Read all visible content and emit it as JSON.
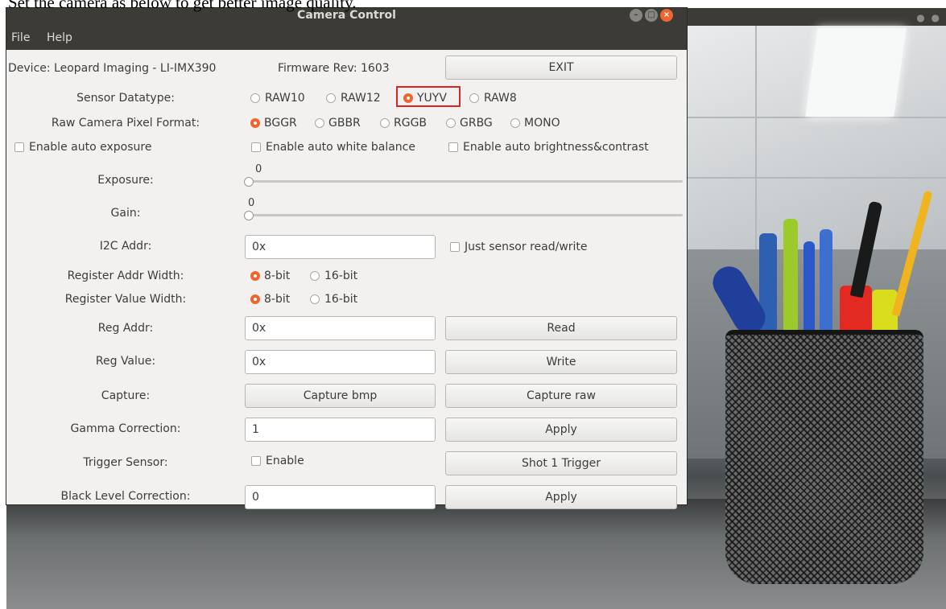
{
  "caption": "Set the camera as below to get better image quality.",
  "window": {
    "title": "Camera Control",
    "menu": [
      "File",
      "Help"
    ]
  },
  "header": {
    "device": "Device: Leopard Imaging - LI-IMX390",
    "firmware": "Firmware Rev: 1603",
    "exit_label": "EXIT"
  },
  "sensor_datatype": {
    "label": "Sensor Datatype:",
    "options": [
      "RAW10",
      "RAW12",
      "YUYV",
      "RAW8"
    ],
    "selected": "YUYV"
  },
  "pixel_format": {
    "label": "Raw Camera Pixel Format:",
    "options": [
      "BGGR",
      "GBBR",
      "RGGB",
      "GRBG",
      "MONO"
    ],
    "selected": "BGGR"
  },
  "checkboxes": {
    "auto_exposure": "Enable auto exposure",
    "auto_white_balance": "Enable auto white balance",
    "auto_brightness": "Enable auto brightness&contrast"
  },
  "exposure": {
    "label": "Exposure:",
    "value": "0"
  },
  "gain": {
    "label": "Gain:",
    "value": "0"
  },
  "i2c": {
    "label": "I2C Addr:",
    "value": "0x",
    "just_sensor": "Just sensor read/write"
  },
  "reg_addr_width": {
    "label": "Register Addr Width:",
    "options": [
      "8-bit",
      "16-bit"
    ],
    "selected": "8-bit"
  },
  "reg_value_width": {
    "label": "Register Value Width:",
    "options": [
      "8-bit",
      "16-bit"
    ],
    "selected": "8-bit"
  },
  "reg_addr": {
    "label": "Reg Addr:",
    "value": "0x",
    "button": "Read"
  },
  "reg_value": {
    "label": "Reg Value:",
    "value": "0x",
    "button": "Write"
  },
  "capture": {
    "label": "Capture:",
    "bmp": "Capture bmp",
    "raw": "Capture raw"
  },
  "gamma": {
    "label": "Gamma Correction:",
    "value": "1",
    "button": "Apply"
  },
  "trigger": {
    "label": "Trigger Sensor:",
    "enable": "Enable",
    "button": "Shot 1 Trigger"
  },
  "black_level": {
    "label": "Black Level Correction:",
    "value": "0",
    "button": "Apply"
  },
  "colors": {
    "titlebar": "#3c3b37",
    "accent": "#f0642f",
    "highlight": "#d62626",
    "window_bg": "#f2f1f0"
  }
}
